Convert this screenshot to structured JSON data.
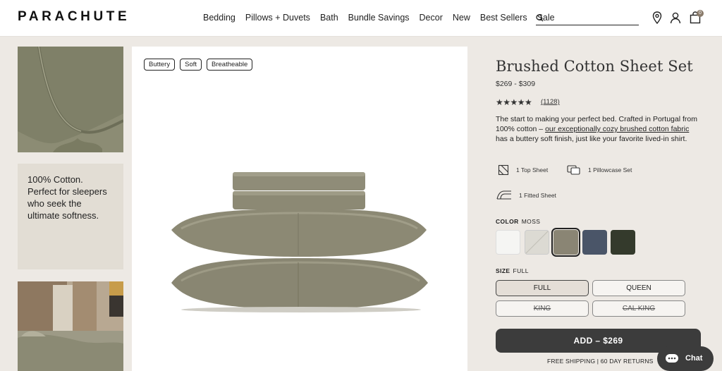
{
  "header": {
    "logo": "PARACHUTE",
    "nav": [
      "Bedding",
      "Pillows + Duvets",
      "Bath",
      "Bundle Savings",
      "Decor",
      "New",
      "Best Sellers",
      "Sale"
    ],
    "search_placeholder": "",
    "cart_count": "0"
  },
  "left": {
    "quote": "100% Cotton. Perfect for sleepers who seek the ultimate softness."
  },
  "main": {
    "tags": [
      "Buttery",
      "Soft",
      "Breatheable"
    ]
  },
  "product": {
    "title": "Brushed Cotton Sheet Set",
    "price": "$269 - $309",
    "rating": 4.5,
    "stars": "★★★★★",
    "review_count": "(1128)",
    "desc_part1": "The start to making your perfect bed. Crafted in Portugal from 100% cotton – ",
    "desc_link": "our exceptionally cozy brushed cotton fabric",
    "desc_part2": " has a buttery soft finish, just like your favorite lived-in shirt.",
    "features": [
      "1 Top Sheet",
      "1 Pillowcase Set",
      "1 Fitted Sheet"
    ],
    "color_label": "COLOR",
    "color_value": "MOSS",
    "colors": [
      {
        "name": "white",
        "hex": "#f5f5f3"
      },
      {
        "name": "light-grey",
        "hex": "#d8d6d0"
      },
      {
        "name": "moss",
        "hex": "#8a8574"
      },
      {
        "name": "blue",
        "hex": "#4a5568"
      },
      {
        "name": "dark-green",
        "hex": "#343a2c"
      }
    ],
    "size_label": "SIZE",
    "size_value": "FULL",
    "sizes": [
      "FULL",
      "QUEEN",
      "KING",
      "CAL KING"
    ],
    "add_button": "ADD – $269",
    "shipping": "FREE SHIPPING | 60 DAY RETURNS",
    "chat": "Chat"
  }
}
